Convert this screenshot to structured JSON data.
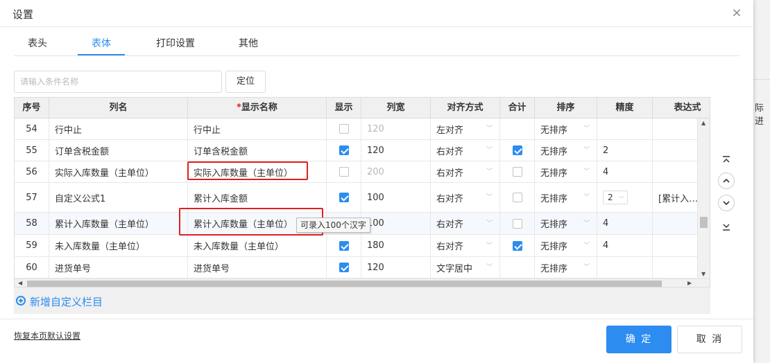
{
  "background": {
    "side_text": "际进"
  },
  "dialog": {
    "title": "设置",
    "close_glyph": "×"
  },
  "tabs": [
    {
      "label": "表头",
      "active": false
    },
    {
      "label": "表体",
      "active": true
    },
    {
      "label": "打印设置",
      "active": false
    },
    {
      "label": "其他",
      "active": false
    }
  ],
  "search": {
    "placeholder": "请输入条件名称",
    "value": "",
    "locate_label": "定位"
  },
  "grid": {
    "columns": [
      "序号",
      "列名",
      "显示名称",
      "显示",
      "列宽",
      "对齐方式",
      "合计",
      "排序",
      "精度",
      "表达式"
    ],
    "required_marker": "*",
    "rows": [
      {
        "seq": "54",
        "name": "行中止",
        "display": "行中止",
        "show": false,
        "width": "120",
        "width_disabled": true,
        "align": "左对齐",
        "sum": null,
        "sort": "无排序",
        "precision": "",
        "expr": ""
      },
      {
        "seq": "55",
        "name": "订单含税金额",
        "display": "订单含税金额",
        "show": true,
        "width": "120",
        "width_disabled": false,
        "align": "右对齐",
        "sum": true,
        "sort": "无排序",
        "precision": "2",
        "expr": ""
      },
      {
        "seq": "56",
        "name": "实际入库数量（主单位）",
        "display": "实际入库数量（主单位）",
        "show": false,
        "width": "200",
        "width_disabled": true,
        "align": "右对齐",
        "sum": false,
        "sort": "无排序",
        "precision": "4",
        "expr": ""
      },
      {
        "seq": "57",
        "name": "自定义公式1",
        "display": "累计入库金额",
        "show": true,
        "width": "100",
        "width_disabled": false,
        "align": "右对齐",
        "sum": false,
        "sort": "无排序",
        "precision": "2",
        "precision_select": true,
        "expr": "[累计入…"
      },
      {
        "seq": "58",
        "name": "累计入库数量（主单位）",
        "display": "累计入库数量（主单位）",
        "show": true,
        "width": "100",
        "width_disabled": false,
        "align": "右对齐",
        "sum": false,
        "sort": "无排序",
        "precision": "4",
        "expr": ""
      },
      {
        "seq": "59",
        "name": "未入库数量（主单位）",
        "display": "未入库数量（主单位）",
        "show": true,
        "width": "180",
        "width_disabled": false,
        "align": "右对齐",
        "sum": true,
        "sort": "无排序",
        "precision": "4",
        "expr": ""
      },
      {
        "seq": "60",
        "name": "进货单号",
        "display": "进货单号",
        "show": true,
        "width": "120",
        "width_disabled": false,
        "align": "文字居中",
        "sum": null,
        "sort": "无排序",
        "precision": "",
        "expr": ""
      }
    ],
    "tooltip": "可录入100个汉字"
  },
  "add_custom": {
    "label": "新增自定义栏目"
  },
  "footer": {
    "restore_label": "恢复本页默认设置",
    "ok_label": "确 定",
    "cancel_label": "取 消"
  },
  "colors": {
    "accent": "#2d8cf0",
    "highlight_box": "#e02020"
  }
}
